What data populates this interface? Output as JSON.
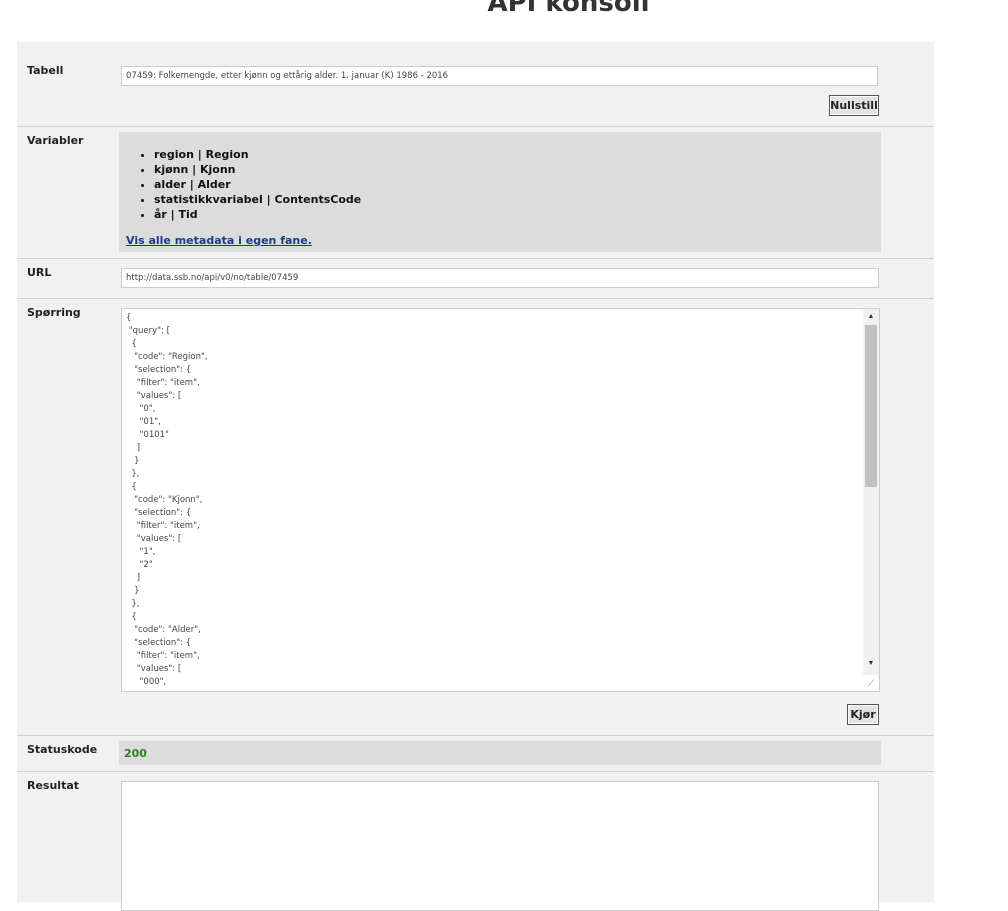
{
  "page": {
    "title": "API konsoll"
  },
  "tabell": {
    "label": "Tabell",
    "value": "07459: Folkemengde, etter kjønn og ettårig alder. 1. januar (K) 1986 - 2016",
    "reset_button": "Nullstill"
  },
  "variabler": {
    "label": "Variabler",
    "items": [
      "region | Region",
      "kjønn | Kjonn",
      "alder | Alder",
      "statistikkvariabel | ContentsCode",
      "år | Tid"
    ],
    "metadata_link": "Vis alle metadata i egen fane."
  },
  "url": {
    "label": "URL",
    "value": "http://data.ssb.no/api/v0/no/table/07459"
  },
  "sporring": {
    "label": "Spørring",
    "query_text": "{\n \"query\": [\n  {\n   \"code\": \"Region\",\n   \"selection\": {\n    \"filter\": \"item\",\n    \"values\": [\n     \"0\",\n     \"01\",\n     \"0101\"\n    ]\n   }\n  },\n  {\n   \"code\": \"Kjonn\",\n   \"selection\": {\n    \"filter\": \"item\",\n    \"values\": [\n     \"1\",\n     \"2\"\n    ]\n   }\n  },\n  {\n   \"code\": \"Alder\",\n   \"selection\": {\n    \"filter\": \"item\",\n    \"values\": [\n     \"000\",",
    "run_button": "Kjør"
  },
  "statuskode": {
    "label": "Statuskode",
    "value": "200",
    "value_color": "#2e7d1e"
  },
  "resultat": {
    "label": "Resultat",
    "value": ""
  },
  "icons": {
    "scroll_up": "scroll-up-arrow-icon",
    "scroll_down": "scroll-down-arrow-icon",
    "resize": "resize-grip-icon"
  }
}
